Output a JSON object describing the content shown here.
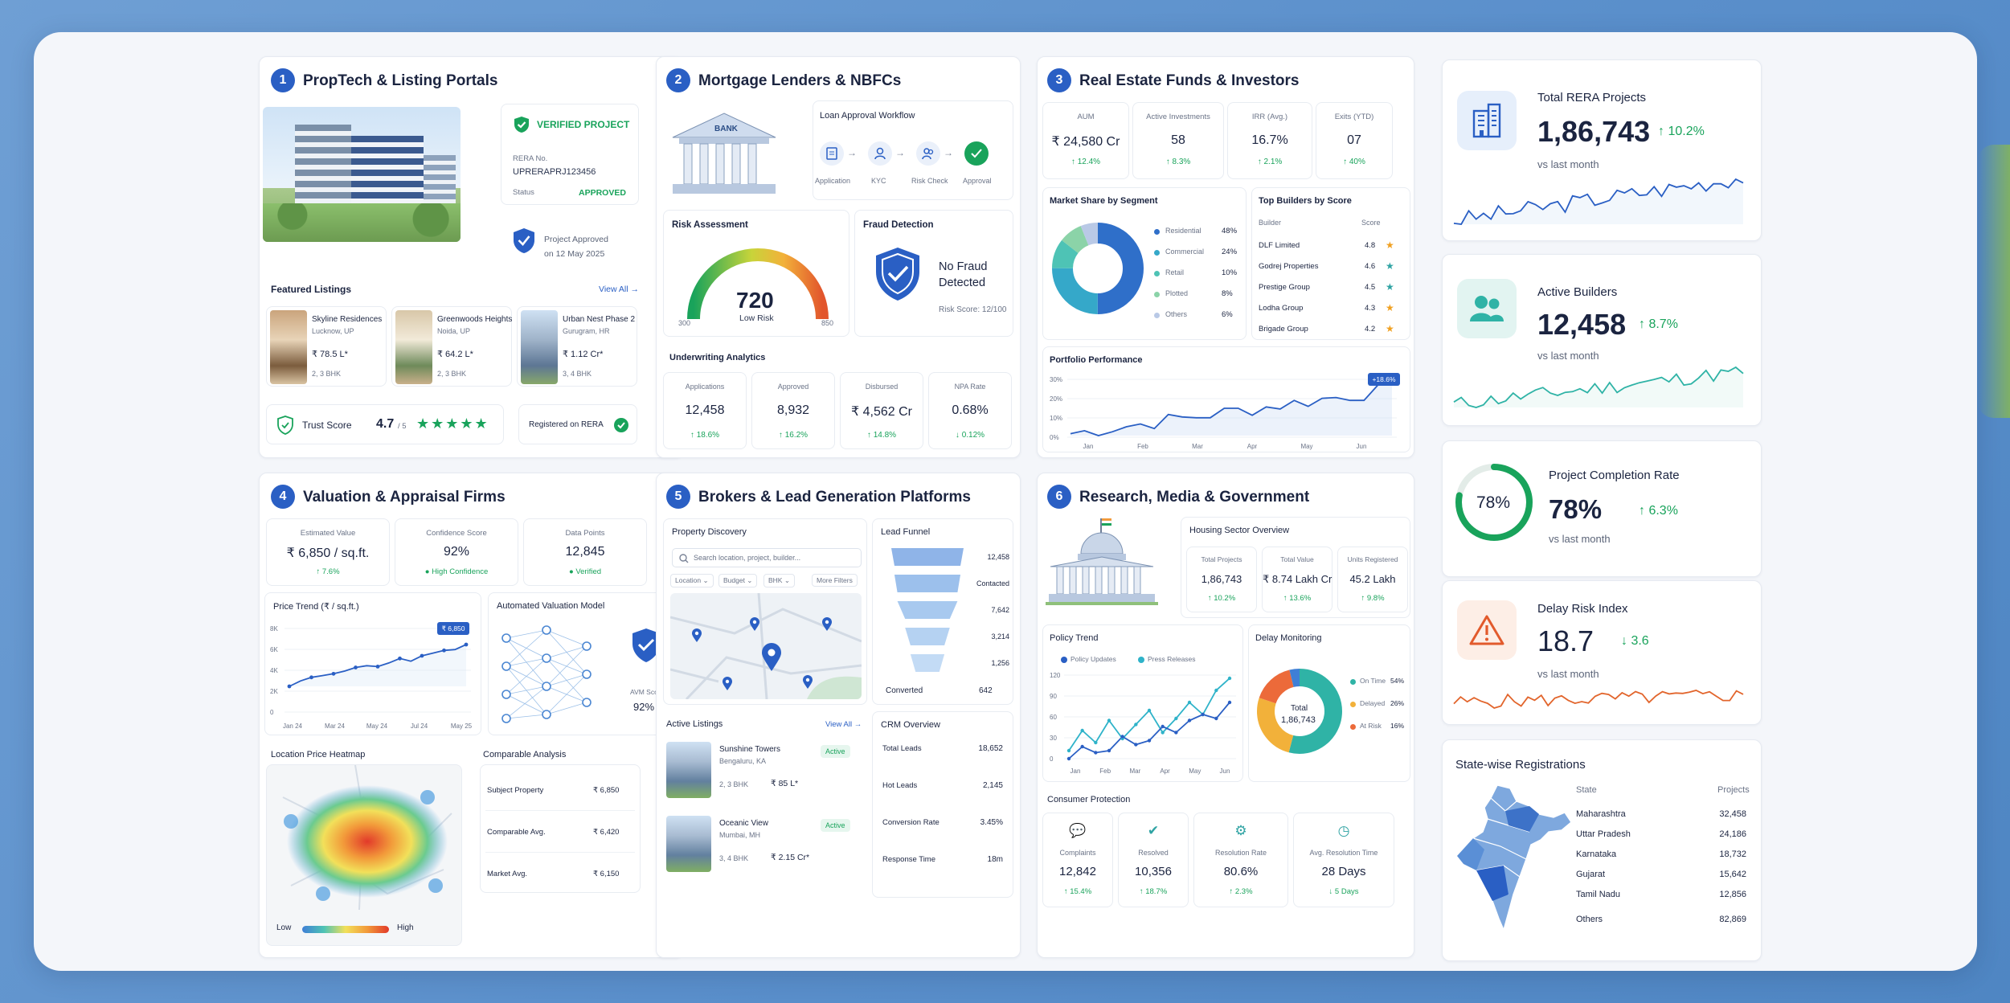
{
  "p1": {
    "num": "1",
    "title": "PropTech & Listing Portals",
    "verified": "VERIFIED PROJECT",
    "rera_label": "RERA No.",
    "rera_no": "UPRERAPRJ123456",
    "status_label": "Status",
    "status_value": "APPROVED",
    "approved_text1": "Project Approved",
    "approved_text2": "on 12 May 2025",
    "featured_title": "Featured Listings",
    "view_all": "View All →",
    "listings": [
      {
        "name": "Skyline Residences",
        "loc": "Lucknow, UP",
        "price": "₹ 78.5 L*",
        "bhk": "2, 3 BHK"
      },
      {
        "name": "Greenwoods Heights",
        "loc": "Noida, UP",
        "price": "₹ 64.2 L*",
        "bhk": "2, 3 BHK"
      },
      {
        "name": "Urban Nest Phase 2",
        "loc": "Gurugram, HR",
        "price": "₹ 1.12 Cr*",
        "bhk": "3, 4 BHK"
      }
    ],
    "trust_label": "Trust Score",
    "trust_value": "4.7",
    "trust_out": "/ 5",
    "registered": "Registered on RERA"
  },
  "p2": {
    "num": "2",
    "title": "Mortgage Lenders & NBFCs",
    "bank": "BANK",
    "workflow_title": "Loan Approval Workflow",
    "steps": [
      "Application",
      "KYC",
      "Risk Check",
      "Approval"
    ],
    "risk_title": "Risk Assessment",
    "risk_value": "720",
    "risk_label": "Low Risk",
    "gauge_min": "300",
    "gauge_max": "850",
    "fraud_title": "Fraud Detection",
    "fraud_l1": "No Fraud",
    "fraud_l2": "Detected",
    "fraud_score": "Risk Score: 12/100",
    "uw_title": "Underwriting Analytics",
    "uw": [
      {
        "label": "Applications",
        "value": "12,458",
        "delta": "↑ 18.6%"
      },
      {
        "label": "Approved",
        "value": "8,932",
        "delta": "↑ 16.2%"
      },
      {
        "label": "Disbursed",
        "value": "₹ 4,562 Cr",
        "delta": "↑ 14.8%"
      },
      {
        "label": "NPA Rate",
        "value": "0.68%",
        "delta": "↓ 0.12%"
      }
    ]
  },
  "p3": {
    "num": "3",
    "title": "Real Estate Funds & Investors",
    "kpis": [
      {
        "label": "AUM",
        "value": "₹ 24,580 Cr",
        "delta": "↑ 12.4%"
      },
      {
        "label": "Active Investments",
        "value": "58",
        "delta": "↑ 8.3%"
      },
      {
        "label": "IRR (Avg.)",
        "value": "16.7%",
        "delta": "↑ 2.1%"
      },
      {
        "label": "Exits (YTD)",
        "value": "07",
        "delta": "↑ 40%"
      }
    ],
    "share_title": "Market Share by Segment",
    "segments": [
      {
        "name": "Residential",
        "pct": "48%",
        "value": 48,
        "color": "#2f6fc9"
      },
      {
        "name": "Commercial",
        "pct": "24%",
        "value": 24,
        "color": "#35a8c9"
      },
      {
        "name": "Retail",
        "pct": "10%",
        "value": 10,
        "color": "#4ec3b5"
      },
      {
        "name": "Plotted",
        "pct": "8%",
        "value": 8,
        "color": "#8bd3a8"
      },
      {
        "name": "Others",
        "pct": "6%",
        "value": 6,
        "color": "#b9c9e6"
      }
    ],
    "builders_title": "Top Builders by Score",
    "builder_head": "Builder",
    "score_head": "Score",
    "builders": [
      {
        "name": "DLF Limited",
        "score": "4.8",
        "star_color": "#f0a020"
      },
      {
        "name": "Godrej Properties",
        "score": "4.6",
        "star_color": "#2fa3a3"
      },
      {
        "name": "Prestige Group",
        "score": "4.5",
        "star_color": "#2fa3a3"
      },
      {
        "name": "Lodha Group",
        "score": "4.3",
        "star_color": "#f0a020"
      },
      {
        "name": "Brigade Group",
        "score": "4.2",
        "star_color": "#f0a020"
      }
    ],
    "portfolio_title": "Portfolio Performance",
    "portfolio_badge": "+18.6%",
    "portfolio_y": [
      "30%",
      "20%",
      "10%",
      "0%"
    ],
    "portfolio_x": [
      "Jan",
      "Feb",
      "Mar",
      "Apr",
      "May",
      "Jun"
    ]
  },
  "p4": {
    "num": "4",
    "title": "Valuation & Appraisal Firms",
    "kpis": [
      {
        "label": "Estimated Value",
        "value": "₹ 6,850 / sq.ft.",
        "delta": "↑ 7.6%"
      },
      {
        "label": "Confidence Score",
        "value": "92%",
        "delta": "● High Confidence"
      },
      {
        "label": "Data Points",
        "value": "12,845",
        "delta": "● Verified"
      }
    ],
    "trend_title": "Price Trend (₹ / sq.ft.)",
    "trend_badge": "₹ 6,850",
    "trend_y": [
      "8K",
      "6K",
      "4K",
      "2K",
      "0"
    ],
    "trend_x": [
      "Jan 24",
      "Mar 24",
      "May 24",
      "Jul 24",
      "May 25"
    ],
    "avm_title": "Automated Valuation Model",
    "avm_label": "AVM Score",
    "avm_value": "92%",
    "heatmap_title": "Location Price Heatmap",
    "heat_low": "Low",
    "heat_high": "High",
    "comp_title": "Comparable Analysis",
    "comps": [
      {
        "label": "Subject Property",
        "value": "₹ 6,850"
      },
      {
        "label": "Comparable Avg.",
        "value": "₹ 6,420"
      },
      {
        "label": "Market Avg.",
        "value": "₹ 6,150"
      }
    ]
  },
  "p5": {
    "num": "5",
    "title": "Brokers & Lead Generation Platforms",
    "discovery_title": "Property Discovery",
    "search_placeholder": "Search location, project, builder...",
    "filters": [
      "Location ⌄",
      "Budget ⌄",
      "BHK ⌄",
      "More Filters"
    ],
    "funnel_title": "Lead Funnel",
    "funnel": [
      {
        "label": "12,458",
        "value": 12458
      },
      {
        "label": "Contacted",
        "value": 9800
      },
      {
        "label": "7,642",
        "value": 7642
      },
      {
        "label": "3,214",
        "value": 3214
      },
      {
        "label": "1,256",
        "value": 1256
      }
    ],
    "converted_label": "Converted",
    "converted_value": "642",
    "active_title": "Active Listings",
    "view_all": "View All →",
    "listings": [
      {
        "name": "Sunshine Towers",
        "loc": "Bengaluru, KA",
        "bhk": "2, 3 BHK",
        "price": "₹ 85 L*",
        "status": "Active"
      },
      {
        "name": "Oceanic View",
        "loc": "Mumbai, MH",
        "bhk": "3, 4 BHK",
        "price": "₹ 2.15 Cr*",
        "status": "Active"
      }
    ],
    "crm_title": "CRM Overview",
    "crm": [
      {
        "label": "Total Leads",
        "value": "18,652"
      },
      {
        "label": "Hot Leads",
        "value": "2,145"
      },
      {
        "label": "Conversion Rate",
        "value": "3.45%"
      },
      {
        "label": "Response Time",
        "value": "18m"
      }
    ]
  },
  "p6": {
    "num": "6",
    "title": "Research, Media & Government",
    "housing_title": "Housing Sector Overview",
    "housing": [
      {
        "label": "Total Projects",
        "value": "1,86,743",
        "delta": "↑ 10.2%"
      },
      {
        "label": "Total Value",
        "value": "₹ 8.74 Lakh Cr",
        "delta": "↑ 13.6%"
      },
      {
        "label": "Units Registered",
        "value": "45.2 Lakh",
        "delta": "↑ 9.8%"
      }
    ],
    "policy_title": "Policy Trend",
    "legend_a": "Policy Updates",
    "legend_b": "Press Releases",
    "policy_y": [
      "120",
      "90",
      "60",
      "30",
      "0"
    ],
    "policy_x": [
      "Jan",
      "Feb",
      "Mar",
      "Apr",
      "May",
      "Jun"
    ],
    "delay_title": "Delay Monitoring",
    "donut_l1": "Total",
    "donut_l2": "1,86,743",
    "delay": [
      {
        "name": "On Time",
        "pct": "54%",
        "value": 54,
        "color": "#2fb3a6"
      },
      {
        "name": "Delayed",
        "pct": "26%",
        "value": 26,
        "color": "#f2b13a"
      },
      {
        "name": "At Risk",
        "pct": "16%",
        "value": 16,
        "color": "#ec6a3a"
      },
      {
        "name": "",
        "pct": "",
        "value": 4,
        "color": "#3f7fd6"
      }
    ],
    "consumer_title": "Consumer Protection",
    "consumer": [
      {
        "label": "Complaints",
        "value": "12,842",
        "delta": "↑ 15.4%"
      },
      {
        "label": "Resolved",
        "value": "10,356",
        "delta": "↑ 18.7%"
      },
      {
        "label": "Resolution Rate",
        "value": "80.6%",
        "delta": "↑ 2.3%"
      },
      {
        "label": "Avg. Resolution Time",
        "value": "28 Days",
        "delta": "↓ 5 Days"
      }
    ]
  },
  "side": {
    "rera": {
      "title": "Total RERA Projects",
      "value": "1,86,743",
      "delta": "↑ 10.2%",
      "sub": "vs last month"
    },
    "builders": {
      "title": "Active Builders",
      "value": "12,458",
      "delta": "↑ 8.7%",
      "sub": "vs last month"
    },
    "completion": {
      "title": "Project Completion Rate",
      "ring": "78%",
      "value": "78%",
      "level": 0.78,
      "delta": "↑ 6.3%",
      "sub": "vs last month"
    },
    "delay": {
      "title": "Delay Risk Index",
      "value": "18.7",
      "delta": "↓ 3.6",
      "sub": "vs last month"
    },
    "states": {
      "title": "State-wise Registrations",
      "state_head": "State",
      "proj_head": "Projects",
      "rows": [
        {
          "state": "Maharashtra",
          "value": "32,458"
        },
        {
          "state": "Uttar Pradesh",
          "value": "24,186"
        },
        {
          "state": "Karnataka",
          "value": "18,732"
        },
        {
          "state": "Gujarat",
          "value": "15,642"
        },
        {
          "state": "Tamil Nadu",
          "value": "12,856"
        },
        {
          "state": "Others",
          "value": "82,869"
        }
      ]
    }
  },
  "colors": {
    "accent": "#2a5fc4",
    "positive": "#19a35b",
    "warning": "#f0a020",
    "danger": "#e25a2c"
  }
}
